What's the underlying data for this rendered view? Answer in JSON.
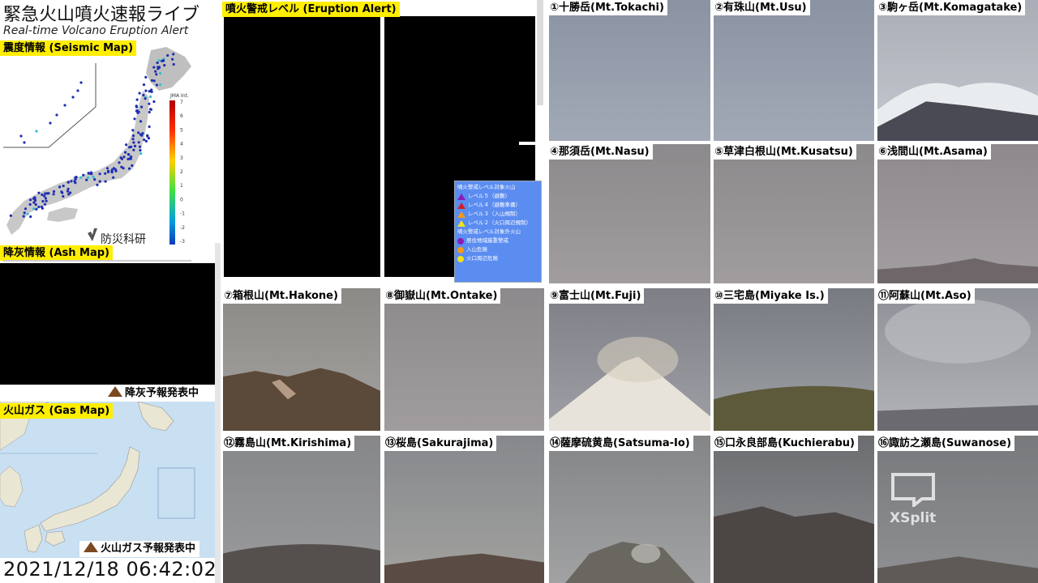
{
  "app": {
    "title": "緊急火山噴火速報ライブ",
    "subtitle": "Real-time Volcano Eruption Alert"
  },
  "seismic_map": {
    "label": "震度情報 (Seismic Map)",
    "scale_title": "JMA Int.",
    "scale_ticks": [
      "7",
      "6",
      "5",
      "4",
      "3",
      "2",
      "1",
      "0",
      "-1",
      "-2",
      "-3"
    ],
    "credit": "防災科研"
  },
  "ash_map": {
    "label": "降灰情報 (Ash Map)",
    "badge": "降灰予報発表中"
  },
  "gas_map": {
    "label": "火山ガス (Gas Map)",
    "badge": "火山ガス予報発表中"
  },
  "clock": "2021/12/18 06:42:02",
  "alert_panel": {
    "label": "噴火警戒レベル (Eruption Alert)",
    "legend_title_a": "噴火警戒レベル対象火山",
    "legend_items_a": [
      "レベル５（避難）",
      "レベル４（避難準備）",
      "レベル３（入山規制）",
      "レベル２（火口周辺規制）"
    ],
    "legend_title_b": "噴火警戒レベル対象外火山",
    "legend_items_b": [
      "居住地域厳重警戒",
      "入山危険",
      "火口周辺危険"
    ],
    "colors": {
      "level5": "#8a1db5",
      "level4": "#d42020",
      "level3": "#f29a1a",
      "level2": "#f2e21a",
      "out1": "#8a1db5",
      "out2": "#f29a1a",
      "out3": "#f2e21a"
    }
  },
  "cameras": [
    {
      "label": "①十勝岳(Mt.Tokachi)",
      "scene": "sky"
    },
    {
      "label": "②有珠山(Mt.Usu)",
      "scene": "sky"
    },
    {
      "label": "③駒ヶ岳(Mt.Komagatake)",
      "scene": "snowpeak"
    },
    {
      "label": "④那須岳(Mt.Nasu)",
      "scene": "fog"
    },
    {
      "label": "⑤草津白根山(Mt.Kusatsu)",
      "scene": "fog"
    },
    {
      "label": "⑥浅間山(Mt.Asama)",
      "scene": "fogridge"
    },
    {
      "label": "⑦箱根山(Mt.Hakone)",
      "scene": "hakone"
    },
    {
      "label": "⑧御嶽山(Mt.Ontake)",
      "scene": "fog"
    },
    {
      "label": "⑨富士山(Mt.Fuji)",
      "scene": "fuji"
    },
    {
      "label": "⑩三宅島(Miyake Is.)",
      "scene": "miyake"
    },
    {
      "label": "⑪阿蘇山(Mt.Aso)",
      "scene": "aso"
    },
    {
      "label": "⑫霧島山(Mt.Kirishima)",
      "scene": "kirishima"
    },
    {
      "label": "⑬桜島(Sakurajima)",
      "scene": "sakurajima"
    },
    {
      "label": "⑭薩摩硫黄島(Satsuma-Io)",
      "scene": "iwo"
    },
    {
      "label": "⑮口永良部島(Kuchierabu)",
      "scene": "kuchi"
    },
    {
      "label": "⑯諏訪之瀬島(Suwanose)",
      "scene": "suwa"
    }
  ],
  "watermark": "XSplit"
}
